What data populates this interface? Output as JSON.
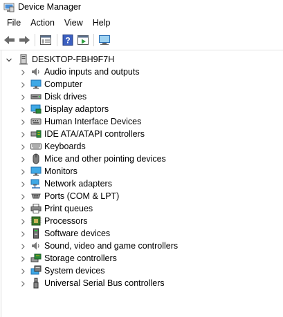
{
  "window": {
    "title": "Device Manager"
  },
  "menu": {
    "items": [
      "File",
      "Action",
      "View",
      "Help"
    ]
  },
  "toolbar": {
    "buttons": [
      "back-arrow-icon",
      "forward-arrow-icon",
      "properties-icon",
      "help-icon",
      "run-icon",
      "monitor-scan-icon"
    ]
  },
  "tree": {
    "root": {
      "label": "DESKTOP-FBH9F7H",
      "icon": "computer-tower-icon"
    },
    "items": [
      {
        "label": "Audio inputs and outputs",
        "icon": "speaker-icon"
      },
      {
        "label": "Computer",
        "icon": "monitor-icon"
      },
      {
        "label": "Disk drives",
        "icon": "disk-drive-icon"
      },
      {
        "label": "Display adaptors",
        "icon": "display-adapter-icon"
      },
      {
        "label": "Human Interface Devices",
        "icon": "hid-icon"
      },
      {
        "label": "IDE ATA/ATAPI controllers",
        "icon": "ide-controller-icon"
      },
      {
        "label": "Keyboards",
        "icon": "keyboard-icon"
      },
      {
        "label": "Mice and other pointing devices",
        "icon": "mouse-icon"
      },
      {
        "label": "Monitors",
        "icon": "monitor-icon"
      },
      {
        "label": "Network adapters",
        "icon": "network-icon"
      },
      {
        "label": "Ports (COM & LPT)",
        "icon": "port-icon"
      },
      {
        "label": "Print queues",
        "icon": "printer-icon"
      },
      {
        "label": "Processors",
        "icon": "processor-icon"
      },
      {
        "label": "Software devices",
        "icon": "software-device-icon"
      },
      {
        "label": "Sound, video and game controllers",
        "icon": "speaker-icon"
      },
      {
        "label": "Storage controllers",
        "icon": "storage-controller-icon"
      },
      {
        "label": "System devices",
        "icon": "system-devices-icon"
      },
      {
        "label": "Universal Serial Bus controllers",
        "icon": "usb-icon"
      }
    ]
  }
}
